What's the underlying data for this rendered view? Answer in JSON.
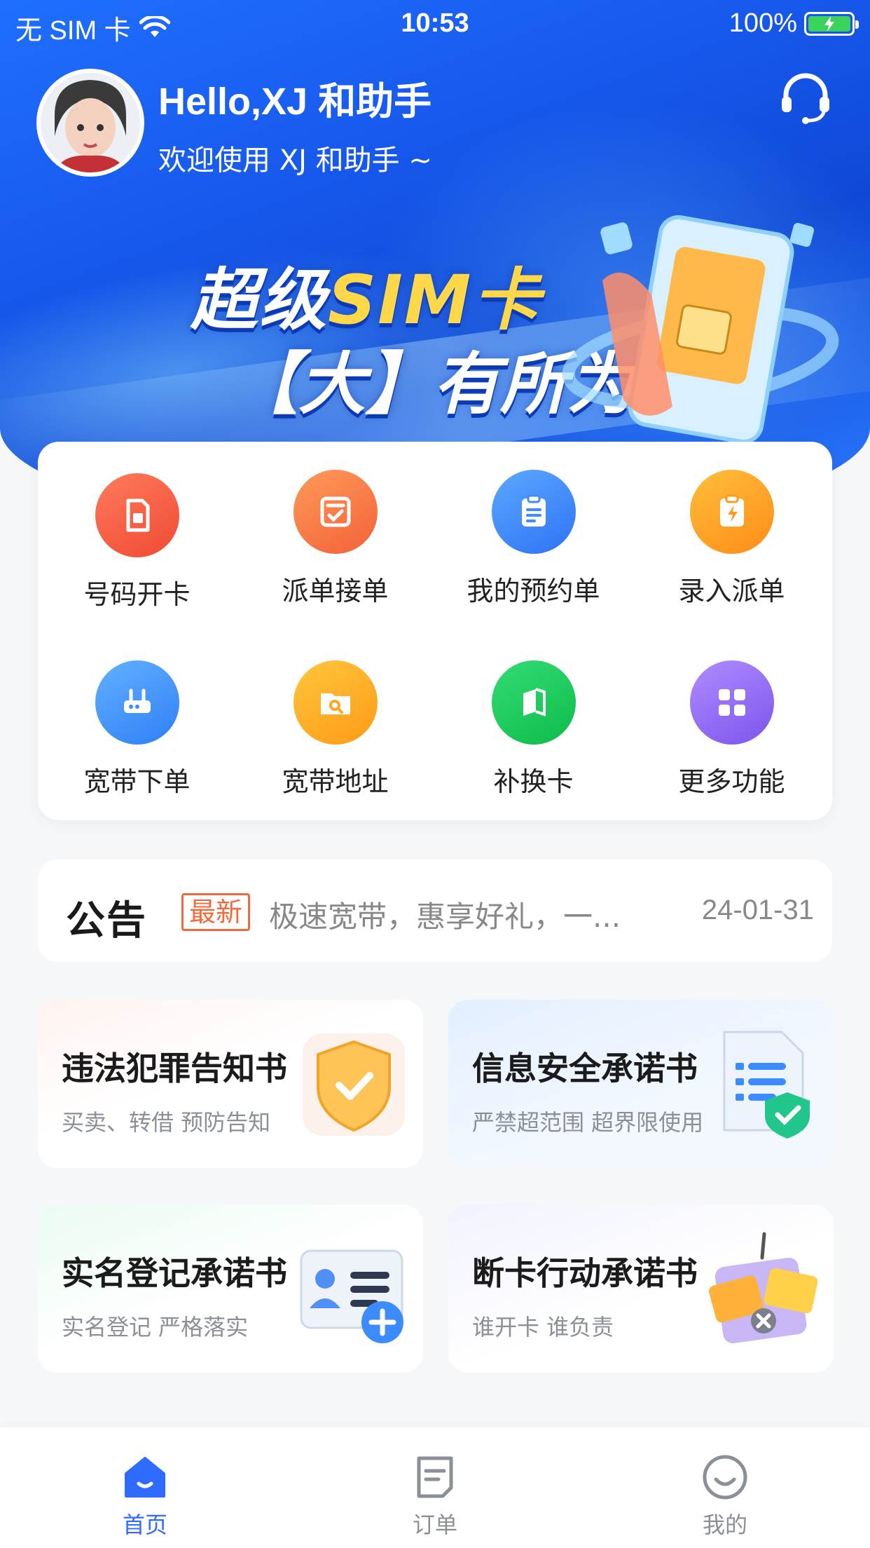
{
  "status_bar": {
    "carrier": "无 SIM 卡",
    "time": "10:53",
    "battery": "100%"
  },
  "header": {
    "greeting": "Hello,XJ 和助手",
    "subtitle": "欢迎使用 XJ 和助手 ~",
    "support_icon": "headset-icon"
  },
  "banner": {
    "line1_pre": "超级",
    "line1_accent": "SIM卡",
    "line2": "【大】有所为"
  },
  "functions": [
    {
      "label": "号码开卡",
      "icon": "sim-card-icon",
      "color": "#f15a3b"
    },
    {
      "label": "派单接单",
      "icon": "checklist-icon",
      "color": "#f8773d"
    },
    {
      "label": "我的预约单",
      "icon": "clipboard-icon",
      "color": "#3f8bff"
    },
    {
      "label": "录入派单",
      "icon": "bolt-clipboard-icon",
      "color": "#ff9a1e"
    },
    {
      "label": "宽带下单",
      "icon": "router-icon",
      "color": "#3d8cff"
    },
    {
      "label": "宽带地址",
      "icon": "folder-search-icon",
      "color": "#ffa81d"
    },
    {
      "label": "补换卡",
      "icon": "card-swap-icon",
      "color": "#17c95a"
    },
    {
      "label": "更多功能",
      "icon": "apps-grid-icon",
      "color": "#8c63f0"
    }
  ],
  "notice": {
    "logo": "公告",
    "tag": "最新",
    "text": "极速宽带，惠享好礼，一...",
    "date": "24-01-31"
  },
  "promises": [
    {
      "title": "违法犯罪告知书",
      "sub": "买卖、转借 预防告知",
      "icon": "shield-check-icon"
    },
    {
      "title": "信息安全承诺书",
      "sub": "严禁超范围 超界限使用",
      "icon": "secure-document-icon"
    },
    {
      "title": "实名登记承诺书",
      "sub": "实名登记 严格落实",
      "icon": "id-card-add-icon"
    },
    {
      "title": "断卡行动承诺书",
      "sub": "谁开卡 谁负责",
      "icon": "cards-cancel-icon"
    }
  ],
  "tabbar": [
    {
      "label": "首页",
      "icon": "home-icon",
      "active": true
    },
    {
      "label": "订单",
      "icon": "order-icon",
      "active": false
    },
    {
      "label": "我的",
      "icon": "smile-icon",
      "active": false
    }
  ],
  "colors": {
    "primary": "#2f6bff",
    "hero_blue": "#1758ec",
    "notice_tag": "#f26a3b"
  }
}
